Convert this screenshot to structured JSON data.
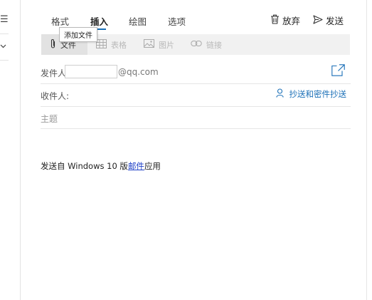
{
  "sidebar": {
    "icons": [
      "list-icon",
      "chevron-down-icon"
    ]
  },
  "tabs": [
    {
      "label": "格式"
    },
    {
      "label": "插入",
      "active": true
    },
    {
      "label": "绘图"
    },
    {
      "label": "选项"
    }
  ],
  "actions": {
    "discard_label": "放弃",
    "send_label": "发送"
  },
  "ribbon": {
    "file_label": "文件",
    "table_label": "表格",
    "picture_label": "图片",
    "link_label": "链接",
    "tooltip": "添加文件"
  },
  "compose": {
    "from_label": "发件人",
    "from_domain": "@qq.com",
    "to_label": "收件人:",
    "cc_label": "抄送和密件抄送",
    "subject_placeholder": "主题",
    "signature": {
      "prefix": "发送自 Windows 10 版",
      "link": "邮件",
      "suffix": "应用"
    }
  },
  "colors": {
    "accent": "#1a6fb7",
    "link": "#1f40c7",
    "ribbon_bg": "#f1f1f1"
  }
}
